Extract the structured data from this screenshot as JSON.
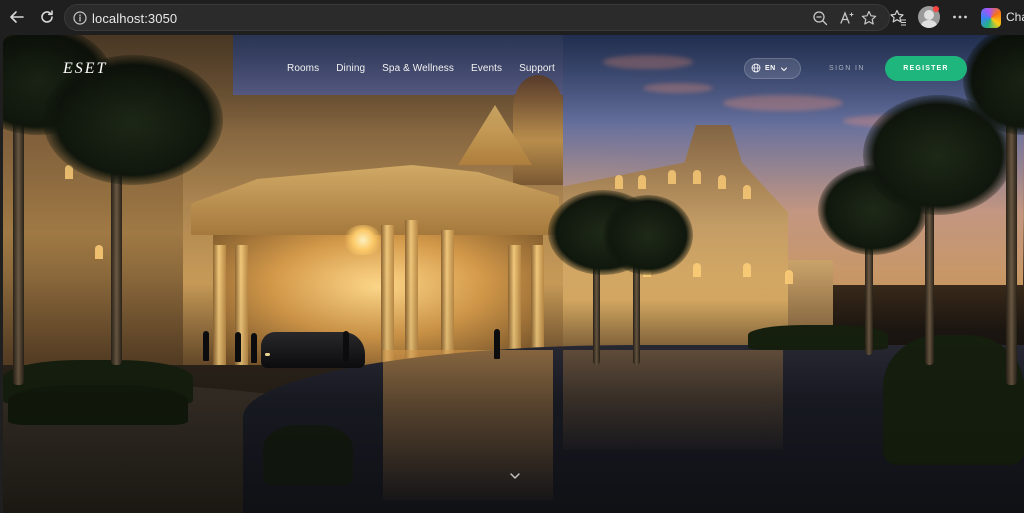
{
  "browser": {
    "url": "localhost:3050",
    "copilot_label": "Cha",
    "icons": [
      "back-arrow-icon",
      "reload-icon",
      "info-icon",
      "zoom-icon",
      "read-aloud-icon",
      "favorite-star-icon",
      "favorites-icon",
      "profile-avatar",
      "more-icon",
      "copilot-icon"
    ]
  },
  "site": {
    "brand": "ESET",
    "nav": [
      "Rooms",
      "Dining",
      "Spa & Wellness",
      "Events",
      "Support"
    ],
    "language": "EN",
    "sign_in": "SIGN IN",
    "register": "REGISTER",
    "colors": {
      "accent": "#1fb67e",
      "nav_text": "#f2f2f2",
      "sign_in_text": "#a7b0bb"
    }
  }
}
